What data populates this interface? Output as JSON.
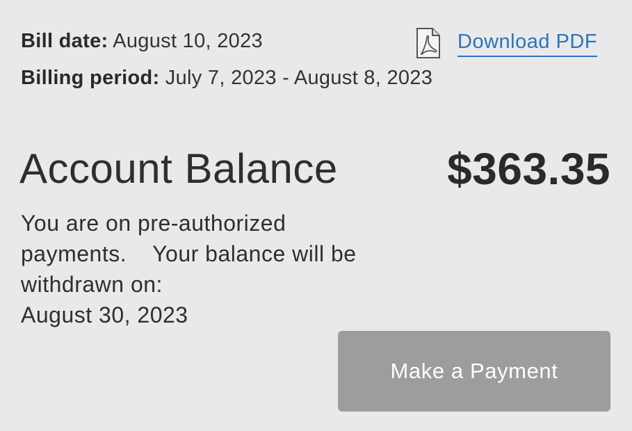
{
  "bill": {
    "date_label": "Bill date:",
    "date_value": "August 10, 2023",
    "period_label": "Billing period:",
    "period_value": "July 7, 2023 - August 8, 2023"
  },
  "download": {
    "icon": "pdf-file-icon",
    "label": "Download PDF",
    "color": "#2d73b7"
  },
  "balance": {
    "title": "Account Balance",
    "amount": "$363.35"
  },
  "payment_info": {
    "text": "You are on pre-authorized\npayments.    Your balance will be\nwithdrawn on:",
    "date": "August 30, 2023"
  },
  "actions": {
    "make_payment_label": "Make a Payment",
    "button_color": "#9d9d9d"
  }
}
